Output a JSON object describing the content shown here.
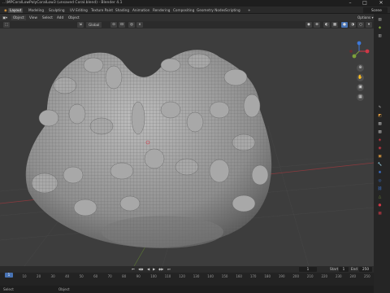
{
  "window": {
    "title": "...\\MPCoralLowPolyCoralLow3 (unsaved Coral.blend) - Blender 4.1",
    "min": "–",
    "max": "□",
    "close": "✕"
  },
  "workspaces": [
    "Layout",
    "Modeling",
    "Sculpting",
    "UV Editing",
    "Texture Paint",
    "Shading",
    "Animation",
    "Rendering",
    "Compositing",
    "Geometry Nodes",
    "Scripting"
  ],
  "active_workspace": "Layout",
  "scene": {
    "name": "Scene",
    "view_layer": "ViewLayer"
  },
  "header": {
    "mode": "Object",
    "menus": [
      "View",
      "Select",
      "Add",
      "Object"
    ],
    "transform_orientation": "Global",
    "visual_options": "Options ▾"
  },
  "timeline": {
    "current_frame": "1",
    "start_label": "Start",
    "start": "1",
    "end_label": "End",
    "end": "250",
    "ruler": [
      "0",
      "10",
      "20",
      "30",
      "40",
      "50",
      "60",
      "70",
      "80",
      "90",
      "100",
      "110",
      "120",
      "130",
      "140",
      "150",
      "160",
      "170",
      "180",
      "190",
      "200",
      "210",
      "220",
      "230",
      "240",
      "250"
    ]
  },
  "statusbar": {
    "left": "Select",
    "middle": "Object"
  },
  "colors": {
    "accent": "#4772b3",
    "x_axis": "#d03846",
    "y_axis": "#7da03a",
    "z_axis": "#3d78d8"
  }
}
